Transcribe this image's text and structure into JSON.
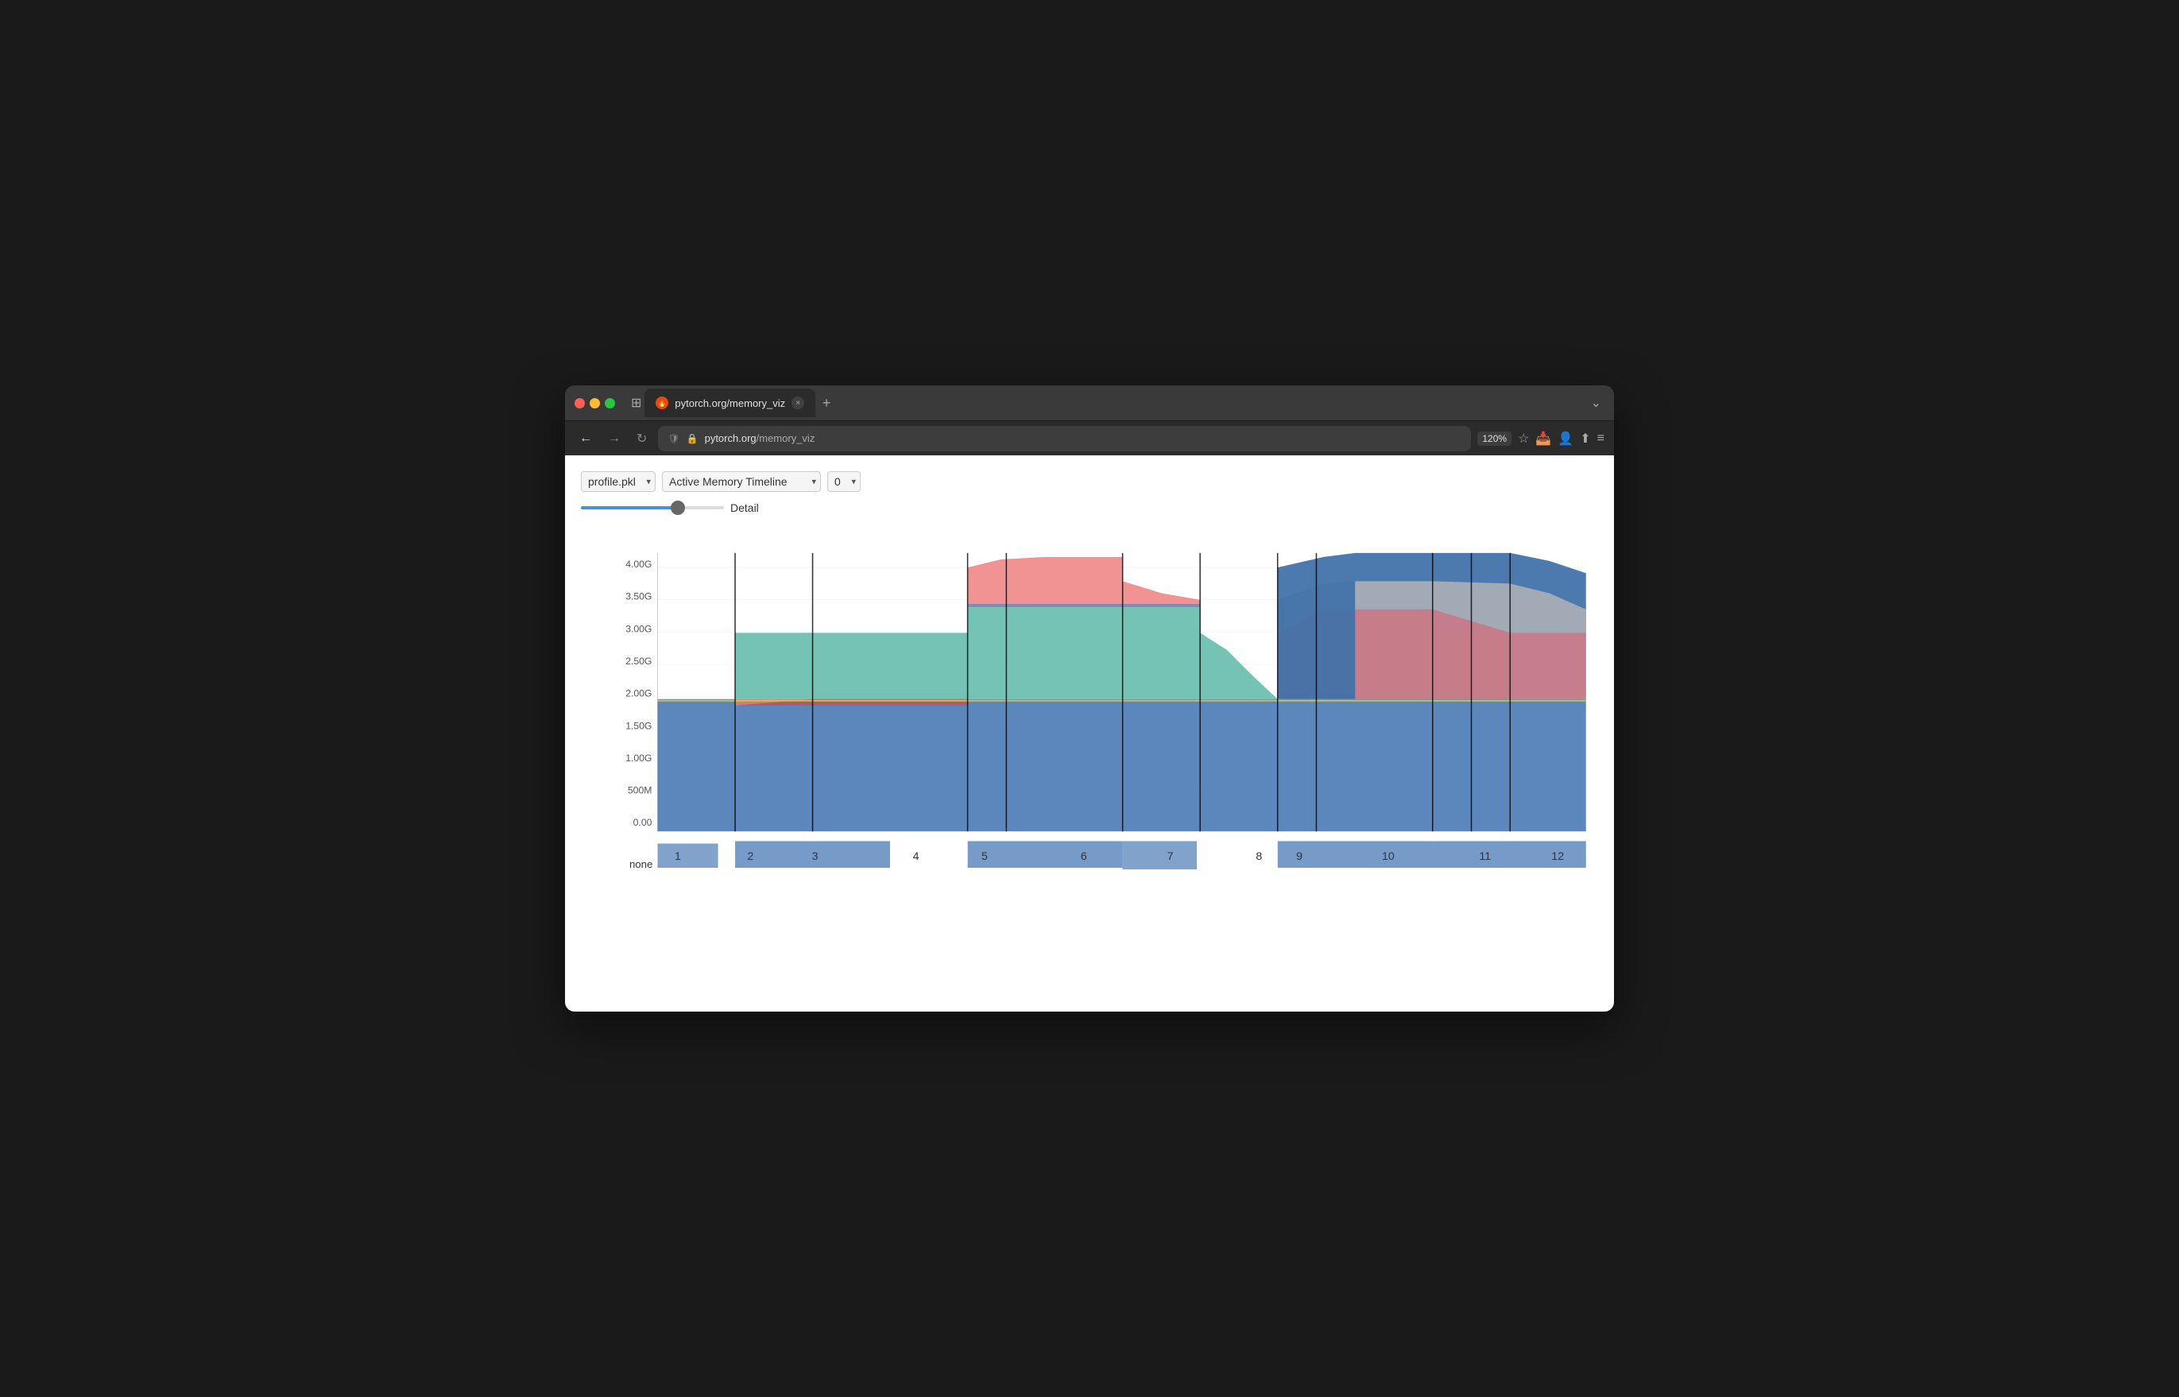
{
  "browser": {
    "title": "pytorch.org/memory_viz",
    "url_protocol": "https://",
    "url_domain": "pytorch.org",
    "url_path": "/memory_viz",
    "zoom": "120%",
    "tab_label": "pytorch.org/memory_viz"
  },
  "toolbar": {
    "file_select": {
      "value": "profile.pkl",
      "options": [
        "profile.pkl"
      ]
    },
    "view_select": {
      "value": "Active Memory Timeline",
      "options": [
        "Active Memory Timeline"
      ]
    },
    "device_select": {
      "value": "0",
      "options": [
        "0"
      ]
    }
  },
  "slider": {
    "label": "Detail",
    "value": 70,
    "min": 0,
    "max": 100
  },
  "chart": {
    "title": "Active Memory Timeline",
    "y_labels": [
      "4.00G",
      "3.50G",
      "3.00G",
      "2.50G",
      "2.00G",
      "1.50G",
      "1.00G",
      "500M",
      "0.00"
    ],
    "x_labels": [
      "1",
      "2",
      "3",
      "4",
      "5",
      "6",
      "7",
      "8",
      "9",
      "10",
      "11",
      "12"
    ],
    "bottom_label": "none",
    "colors": {
      "blue_base": "#4a7ab5",
      "teal": "#5db8a8",
      "pink": "#f08080",
      "red_stripe": "#c05050",
      "purple": "#8b7bb5",
      "yellow": "#d4c84a",
      "gray": "#a8a8a8",
      "blue_bottom": "#5a8ac0"
    }
  }
}
